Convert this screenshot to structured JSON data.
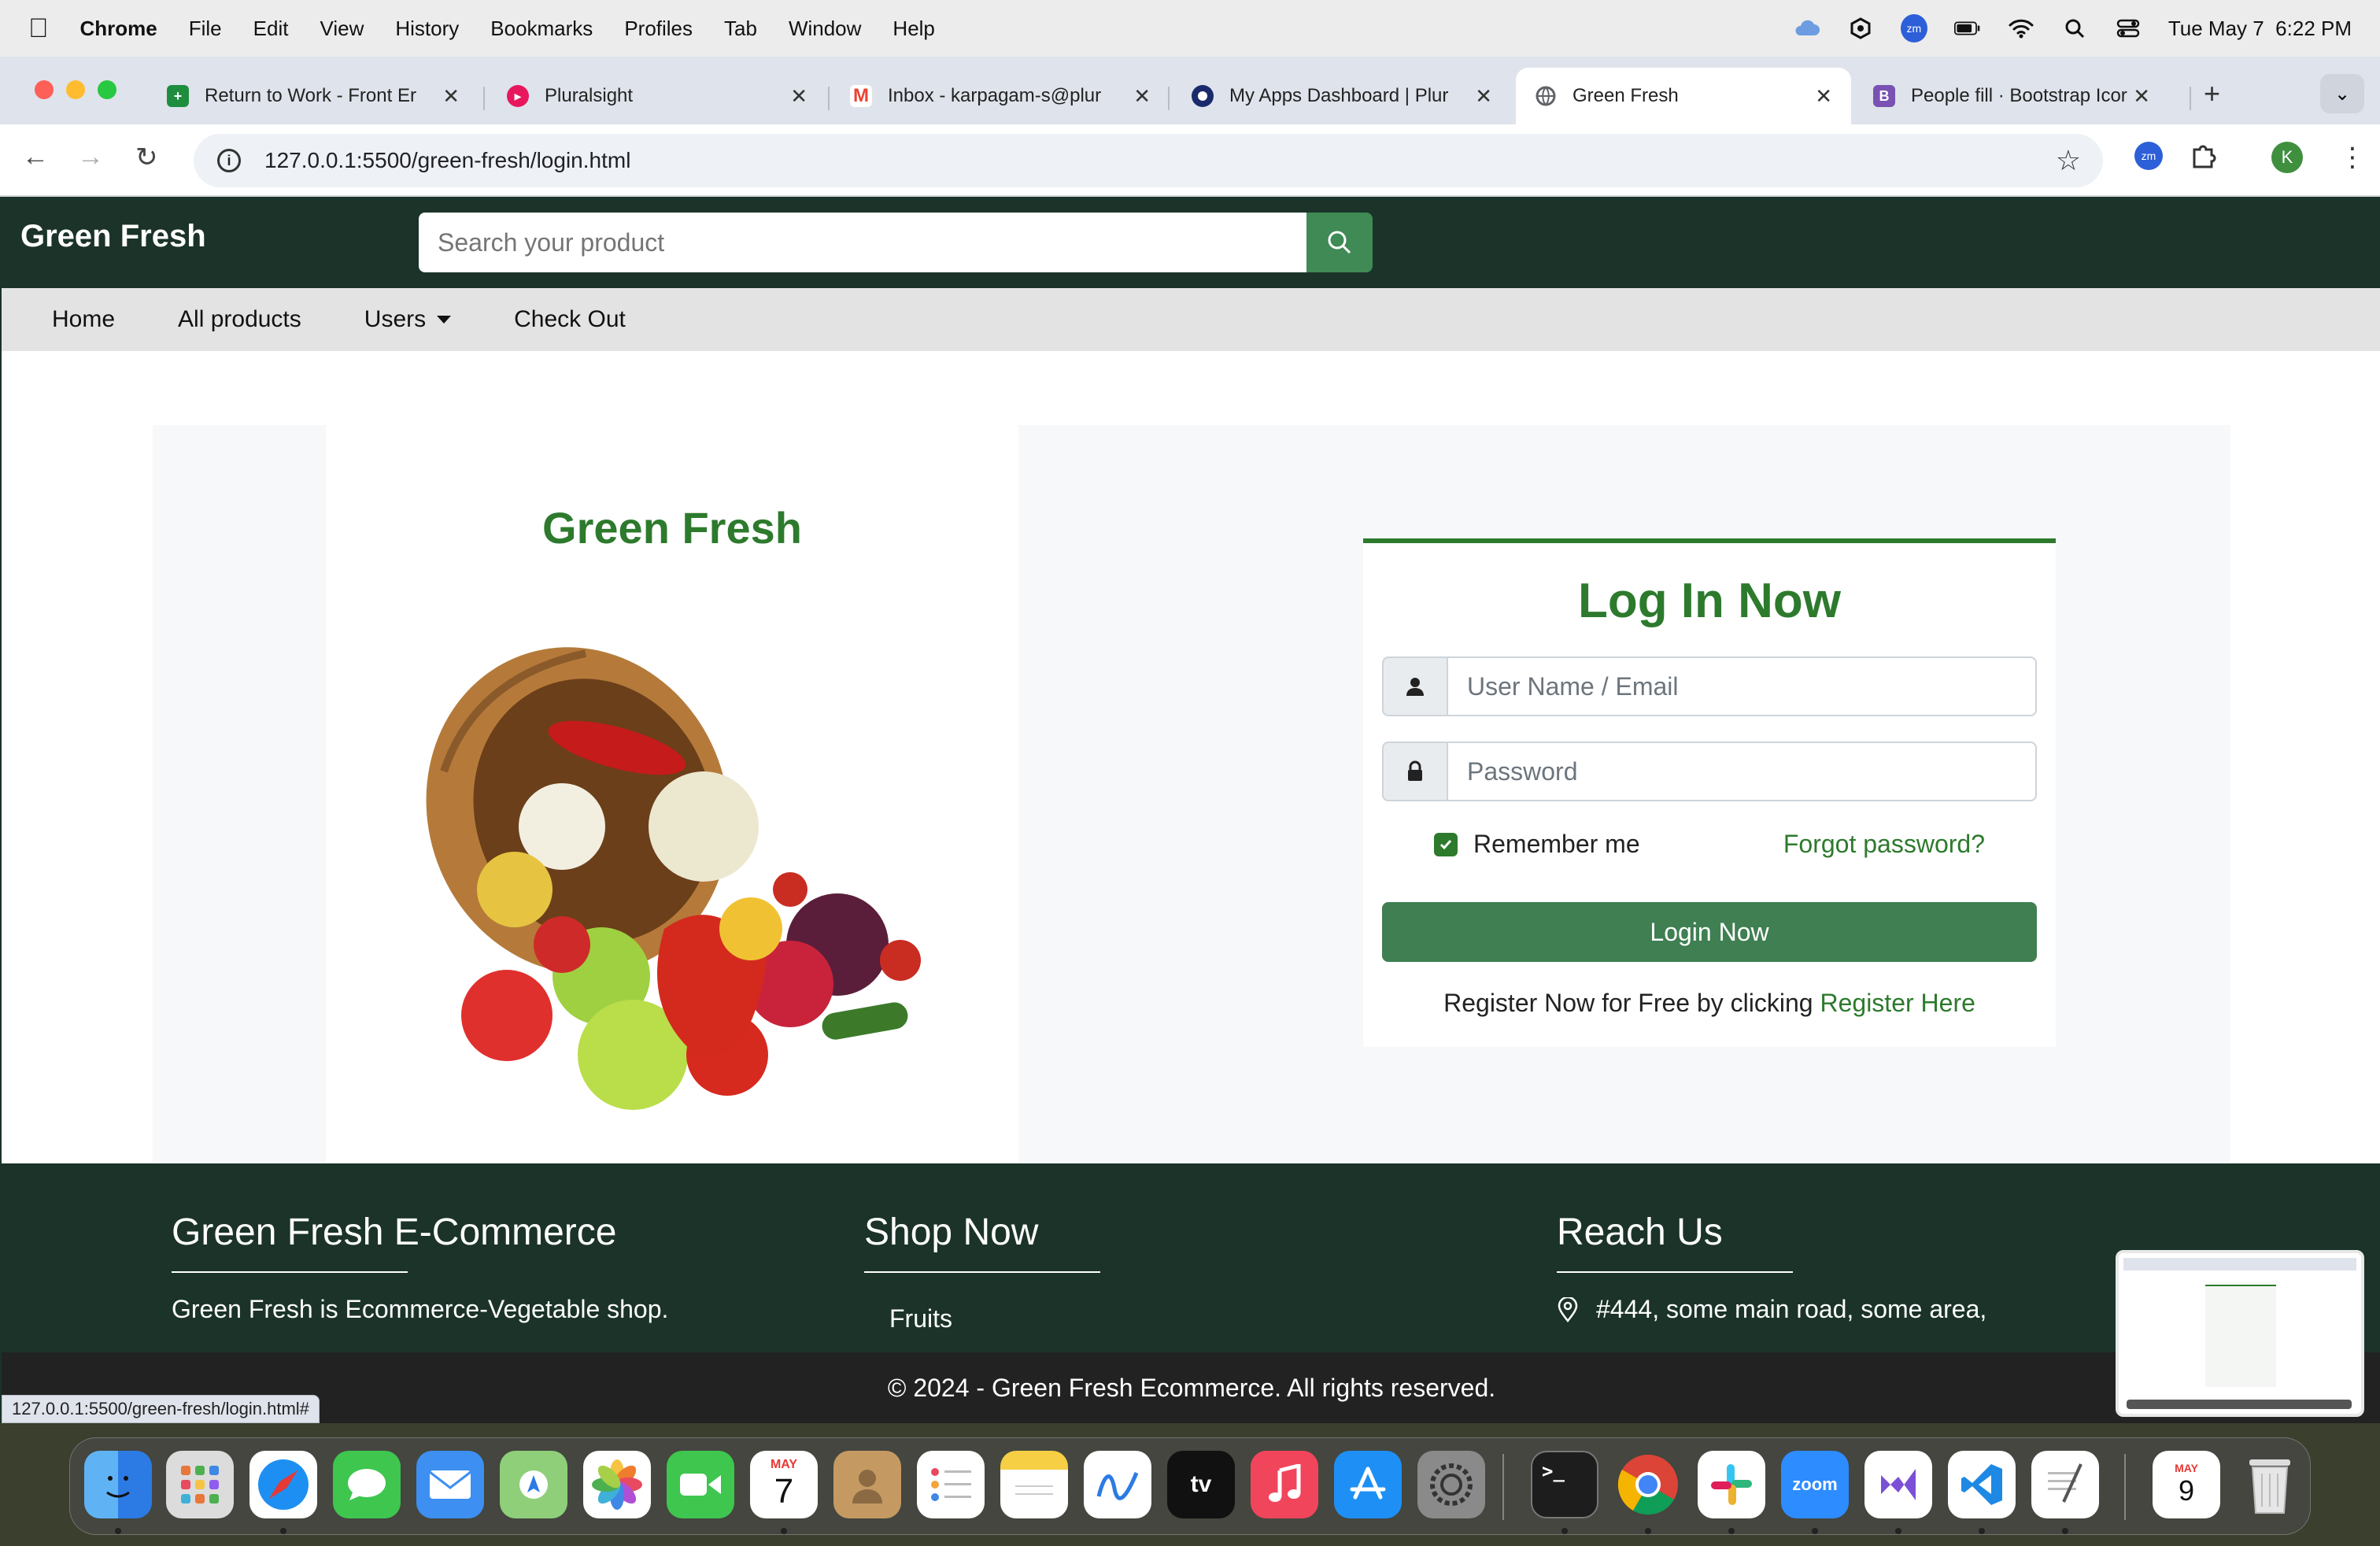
{
  "menubar": {
    "app": "Chrome",
    "items": [
      "File",
      "Edit",
      "View",
      "History",
      "Bookmarks",
      "Profiles",
      "Tab",
      "Window",
      "Help"
    ],
    "clock": "Tue May 7  6:22 PM",
    "zoom_badge": "zm"
  },
  "tabs": [
    {
      "label": "Return to Work - Front Er",
      "icon": "sheets-icon",
      "color": "#1e8e3e"
    },
    {
      "label": "Pluralsight",
      "icon": "pluralsight-icon",
      "color": "#e8175d"
    },
    {
      "label": "Inbox - karpagam-s@plur",
      "icon": "gmail-icon",
      "color": "#ea4335"
    },
    {
      "label": "My Apps Dashboard | Plur",
      "icon": "okta-icon",
      "color": "#1a2b6b"
    },
    {
      "label": "Green Fresh",
      "icon": "globe-icon",
      "color": "#5f6368"
    },
    {
      "label": "People fill · Bootstrap Icor",
      "icon": "bootstrap-icon",
      "color": "#7952b3"
    }
  ],
  "bootstrap_letter": "B",
  "omnibox": {
    "url": "127.0.0.1:5500/green-fresh/login.html"
  },
  "profile_initial": "K",
  "site": {
    "brand": "Green Fresh",
    "search_placeholder": "Search your product",
    "nav": [
      "Home",
      "All products",
      "Users",
      "Check Out"
    ],
    "hero_title": "Green Fresh",
    "login": {
      "title": "Log In Now",
      "user_placeholder": "User Name / Email",
      "password_placeholder": "Password",
      "remember": "Remember me",
      "remember_checked": true,
      "forgot": "Forgot password?",
      "button": "Login Now",
      "register_text": "Register Now for Free by clicking",
      "register_link": "Register Here"
    },
    "footer": {
      "col1_title": "Green Fresh E-Commerce",
      "col1_text": "Green Fresh is Ecommerce-Vegetable shop.",
      "col2_title": "Shop Now",
      "col2_item": "Fruits",
      "col3_title": "Reach Us",
      "col3_text": "#444, some main road, some area,"
    },
    "copyright": "© 2024 - Green Fresh Ecommerce. All rights reserved."
  },
  "status_url": "127.0.0.1:5500/green-fresh/login.html#",
  "dock": {
    "calendar_month": "MAY",
    "calendar_day": "7",
    "calendar2_month": "MAY",
    "calendar2_day": "9",
    "tv_label": "tv",
    "zoom_label": "zoom"
  },
  "colors": {
    "brand_dark": "#1b3329",
    "accent_green": "#2d7a2d",
    "button_green": "#3f7f52"
  }
}
